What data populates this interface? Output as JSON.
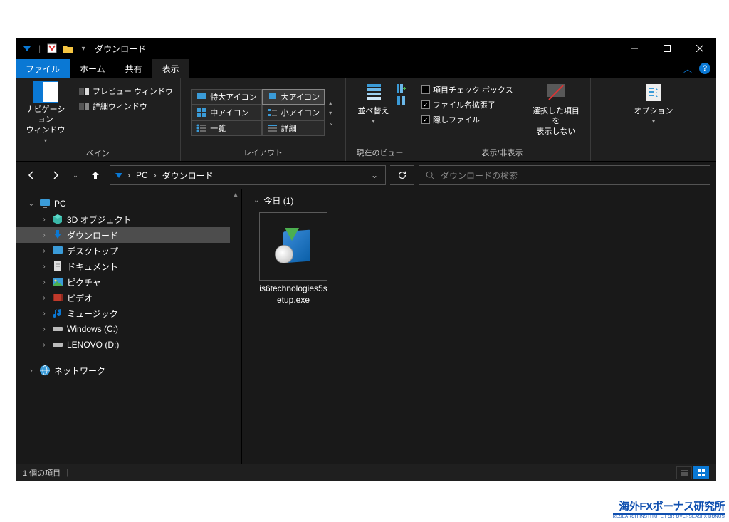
{
  "title": "ダウンロード",
  "tabs": {
    "file": "ファイル",
    "home": "ホーム",
    "share": "共有",
    "view": "表示"
  },
  "ribbon": {
    "pane": {
      "nav": "ナビゲーション\nウィンドウ",
      "preview": "プレビュー ウィンドウ",
      "detail": "詳細ウィンドウ",
      "label": "ペイン"
    },
    "layout": {
      "xl": "特大アイコン",
      "l": "大アイコン",
      "m": "中アイコン",
      "s": "小アイコン",
      "list": "一覧",
      "details": "詳細",
      "label": "レイアウト"
    },
    "sort": {
      "main": "並べ替え",
      "label": "現在のビュー"
    },
    "show": {
      "chk": "項目チェック ボックス",
      "ext": "ファイル名拡張子",
      "hidden": "隠しファイル",
      "hide_sel": "選択した項目を\n表示しない",
      "label": "表示/非表示"
    },
    "options": "オプション"
  },
  "breadcrumb": {
    "pc": "PC",
    "downloads": "ダウンロード"
  },
  "search_placeholder": "ダウンロードの検索",
  "tree": {
    "pc": "PC",
    "items": [
      "3D オブジェクト",
      "ダウンロード",
      "デスクトップ",
      "ドキュメント",
      "ピクチャ",
      "ビデオ",
      "ミュージック",
      "Windows (C:)",
      "LENOVO (D:)"
    ],
    "network": "ネットワーク"
  },
  "content": {
    "group": "今日 (1)",
    "file": "is6technologies5setup.exe"
  },
  "status": "1 個の項目",
  "watermark": {
    "main": "海外FXボーナス研究所",
    "sub": "RESEARCH INSTITUTE FOR OVERSEASFX BONUS"
  }
}
